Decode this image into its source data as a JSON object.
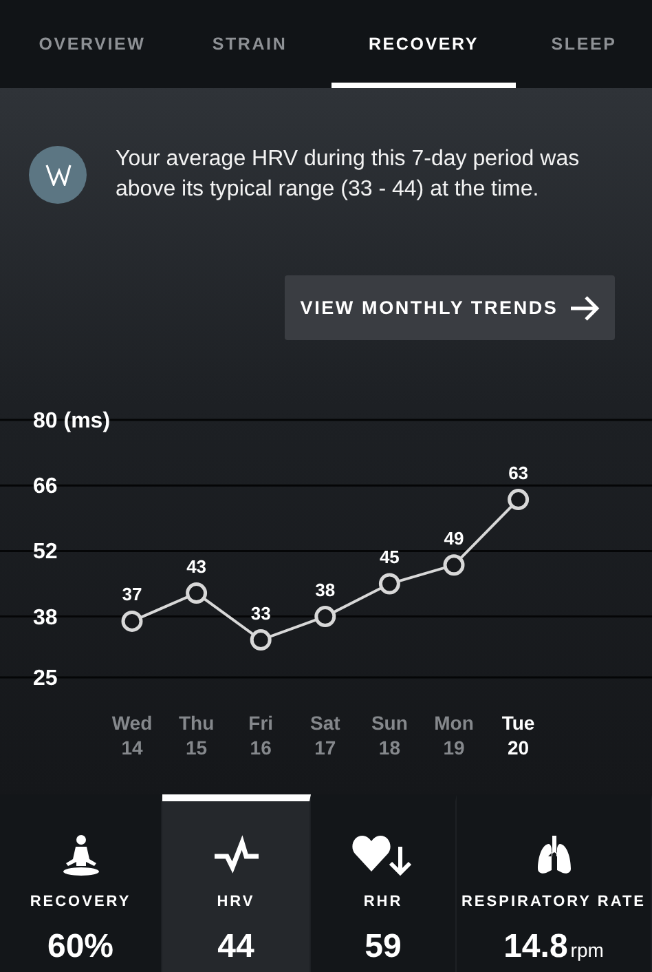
{
  "tabs": [
    {
      "label": "OVERVIEW",
      "selected": false
    },
    {
      "label": "STRAIN",
      "selected": false
    },
    {
      "label": "RECOVERY",
      "selected": true
    },
    {
      "label": "SLEEP",
      "selected": false
    }
  ],
  "insight": {
    "text": "Your average HRV during this 7-day period was above its typical range (33 - 44) at the time."
  },
  "trends_button": {
    "label": "VIEW MONTHLY TRENDS"
  },
  "chart": {
    "chart_data": {
      "type": "line",
      "grid": true,
      "categories": [
        "Wed 14",
        "Thu 15",
        "Fri 16",
        "Sat 17",
        "Sun 18",
        "Mon 19",
        "Tue 20"
      ],
      "series": [
        {
          "color": "#d8d8d8",
          "marker": "circle",
          "values": [
            37,
            43,
            33,
            38,
            45,
            49,
            63
          ]
        }
      ],
      "ylim": [
        25,
        80
      ],
      "yticks": [
        25,
        38,
        52,
        66,
        {
          "value": 80,
          "label": "80 (ms)"
        }
      ],
      "data_labels": true
    },
    "days": [
      {
        "selected": false
      },
      {
        "selected": false
      },
      {
        "selected": false
      },
      {
        "selected": false
      },
      {
        "selected": false
      },
      {
        "selected": false
      },
      {
        "selected": true
      }
    ]
  },
  "metrics": [
    {
      "kind": "recovery",
      "label": "RECOVERY",
      "value": "60%",
      "selected": false
    },
    {
      "kind": "hrv",
      "label": "HRV",
      "value": "44",
      "selected": true
    },
    {
      "kind": "rhr",
      "label": "RHR",
      "value": "59",
      "selected": false
    },
    {
      "kind": "respiratory",
      "label": "RESPIRATORY RATE",
      "value": "14.8",
      "unit": "rpm",
      "selected": false
    }
  ]
}
